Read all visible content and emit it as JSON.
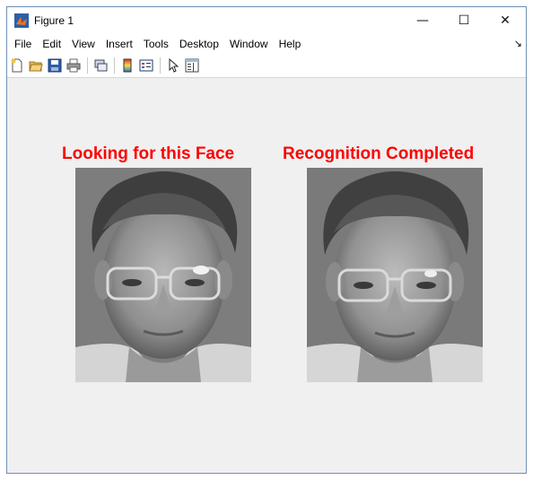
{
  "window": {
    "title": "Figure 1",
    "minimize_glyph": "—",
    "maximize_glyph": "☐",
    "close_glyph": "✕"
  },
  "menu": {
    "items": [
      "File",
      "Edit",
      "View",
      "Insert",
      "Tools",
      "Desktop",
      "Window",
      "Help"
    ],
    "dock_glyph": "↘"
  },
  "toolbar": {
    "icons": [
      "new-figure-icon",
      "open-file-icon",
      "save-icon",
      "print-icon",
      "link-plot-icon",
      "colorbar-icon",
      "legend-icon",
      "pointer-icon",
      "property-inspector-icon"
    ]
  },
  "axes": {
    "left_title": "Looking for this Face",
    "right_title": "Recognition Completed",
    "title_color": "#ff0000"
  }
}
